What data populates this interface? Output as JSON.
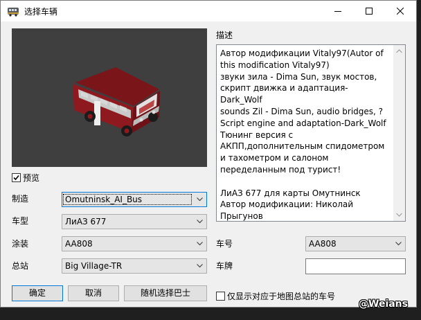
{
  "window": {
    "title": "选择车辆",
    "controls": {
      "minimize": "minimize-icon",
      "maximize": "maximize-icon",
      "close": "close-icon"
    }
  },
  "preview": {
    "checkbox_label": "预览",
    "checked": true
  },
  "fields": {
    "manufacturer": {
      "label": "制造",
      "value": "Omutninsk_AI_Bus"
    },
    "model": {
      "label": "车型",
      "value": "ЛиАЗ 677"
    },
    "livery": {
      "label": "涂装",
      "value": "AA808"
    },
    "depot": {
      "label": "总站",
      "value": "Big Village-TR"
    },
    "vehicle_number": {
      "label": "车号",
      "value": "AA808"
    },
    "plate": {
      "label": "车牌",
      "value": ""
    }
  },
  "description": {
    "label": "描述",
    "text": "Автор модификации Vitaly97(Autor of this modification Vitaly97)\nзвуки зила - Dima Sun, звук мостов, скрипт движка и адаптация- Dark_Wolf\nsounds Zil - Dima Sun, audio bridges, ? Script engine and adaptation-Dark_Wolf\nТюнинг версия с АКПП,дополнительным спидометром и тахометром и салоном переделанным под турист!\n\nЛиАЗ 677 для карты Омутнинск\nАвтор модификации: Николай Прыгунов"
  },
  "buttons": {
    "ok": "确定",
    "cancel": "取消",
    "random": "随机选择巴士"
  },
  "filter_checkbox": {
    "label": "仅显示对应于地图总站的车号",
    "checked": false
  },
  "watermark": "@Weians",
  "colors": {
    "bus_red": "#8e1a1f",
    "preview_bg": "#3f3f3f",
    "focus_blue": "#0078d7"
  }
}
